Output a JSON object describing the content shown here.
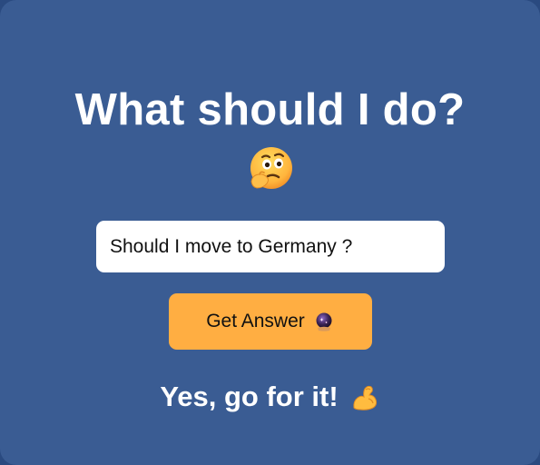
{
  "header": {
    "title": "What should I do?",
    "title_emoji": "thinking-face-icon"
  },
  "question": {
    "value": "Should I move to Germany ?",
    "placeholder": ""
  },
  "button": {
    "label": "Get Answer",
    "icon": "crystal-ball-icon"
  },
  "answer": {
    "text": "Yes, go for it!",
    "icon": "flexed-biceps-icon"
  },
  "colors": {
    "background": "#3a5c93",
    "button": "#ffae42",
    "text": "#ffffff"
  }
}
